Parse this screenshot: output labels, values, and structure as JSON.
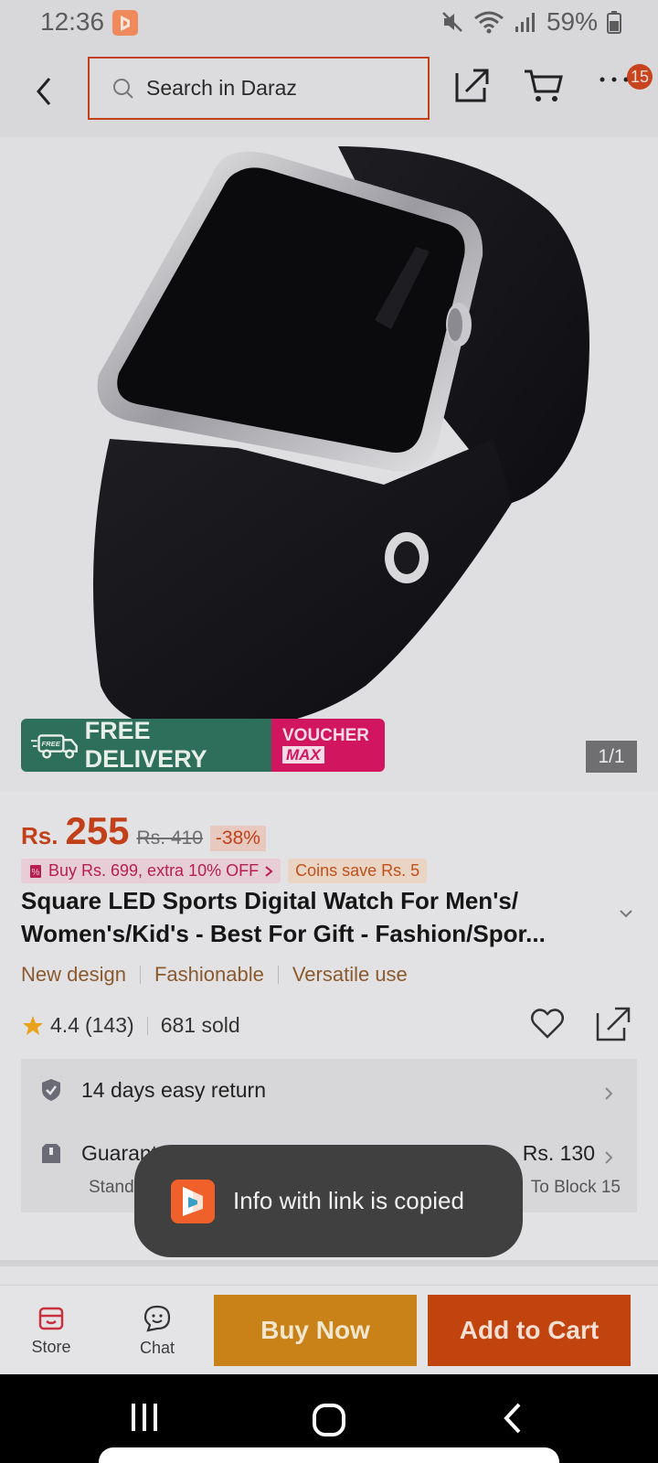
{
  "status_bar": {
    "time": "12:36",
    "battery": "59%",
    "icons": [
      "daraz-app-icon",
      "mute-icon",
      "wifi-icon",
      "signal-icon",
      "battery-icon"
    ]
  },
  "header": {
    "search_placeholder": "Search in Daraz",
    "cart_badge": "15",
    "icons": [
      "back-arrow-icon",
      "search-icon",
      "share-icon",
      "cart-icon",
      "more-icon"
    ]
  },
  "gallery": {
    "counter": "1/1",
    "promo_free": "FREE DELIVERY",
    "promo_free_icon_text": "FREE",
    "promo_voucher_line1": "VOUCHER",
    "promo_voucher_line2": "MAX"
  },
  "product": {
    "currency": "Rs.",
    "price": "255",
    "original_price": "Rs. 410",
    "discount": "-38%",
    "promo_offer": "Buy Rs. 699, extra 10% OFF",
    "coins": "Coins save Rs. 5",
    "title": "Square LED Sports Digital Watch For Men's/ Women's/Kid's - Best For Gift - Fashion/Spor...",
    "tags": [
      "New design",
      "Fashionable",
      "Versatile use"
    ],
    "rating": "4.4",
    "reviews": "(143)",
    "sold": "681 sold"
  },
  "services": {
    "return": "14 days easy return",
    "delivery_title": "Guaranteed by 28 Feb-2 Mar",
    "delivery_type": "Standard Delivery",
    "delivery_price": "Rs. 130",
    "delivery_location": "To Block 15"
  },
  "toast": {
    "text": "Info with link is copied"
  },
  "actions": {
    "store": "Store",
    "chat": "Chat",
    "buy_now": "Buy Now",
    "add_to_cart": "Add to Cart"
  },
  "colors": {
    "brand_orange": "#c1401a",
    "buy_now": "#c88218",
    "add_to_cart": "#c1440e",
    "free_delivery": "#2e6f5b",
    "voucher": "#d1155f"
  }
}
